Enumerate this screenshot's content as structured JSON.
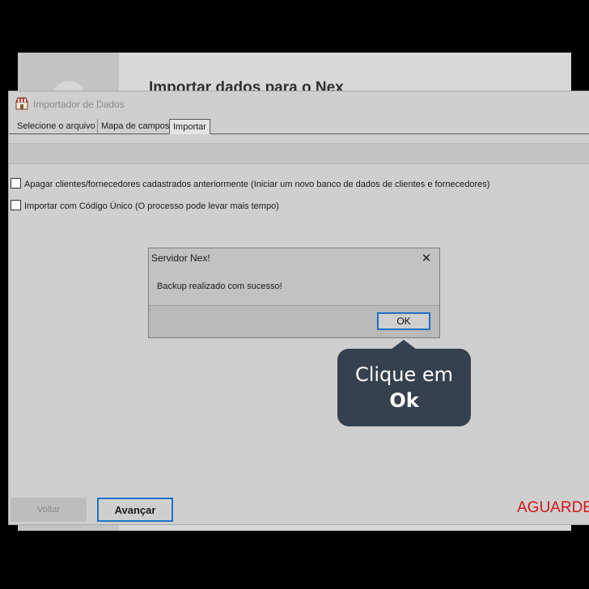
{
  "background_window": {
    "title": "Importar dados para o Nex"
  },
  "importer": {
    "title": "Importador de Dados",
    "tabs": [
      {
        "label": "Selecione o arquivo"
      },
      {
        "label": "Mapa de campos"
      },
      {
        "label": "Importar",
        "active": true
      }
    ],
    "options": [
      {
        "label": "Apagar clientes/fornecedores cadastrados anteriormente (Iniciar um novo banco de dados de clientes e fornecedores)",
        "checked": false
      },
      {
        "label": "Importar com Código Único (O processo pode levar mais tempo)",
        "checked": false
      }
    ],
    "buttons": {
      "back_label": "Voltar",
      "next_label": "Avançar"
    },
    "status_text": "AGUARDE"
  },
  "dialog": {
    "title": "Servidor Nex!",
    "message": "Backup realizado com sucesso!",
    "ok_label": "OK",
    "close_icon": "close-icon"
  },
  "callout": {
    "line1": "Clique em",
    "line2": "Ok"
  },
  "colors": {
    "accent": "#1e72c6",
    "status": "#d01818",
    "callout_bg": "#36414f"
  }
}
